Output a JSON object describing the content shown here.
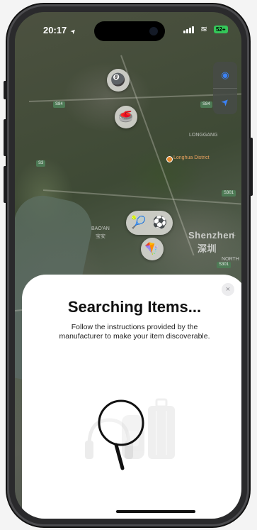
{
  "status_bar": {
    "time": "20:17",
    "location_arrow": "➤",
    "wifi": "≋",
    "battery": "52+"
  },
  "map": {
    "labels": {
      "longgang": "LONGGANG",
      "baoan": "BAO'AN",
      "baoan_cn": "宝安",
      "shenzhen": "Shenzhen",
      "shenzhen_cn": "深圳",
      "north": "NORTH",
      "l_edge": "L",
      "poi": "Longhua District"
    },
    "road_shields": [
      "S84",
      "S84",
      "S3",
      "S301",
      "S301"
    ],
    "controls": {
      "map_icon": "◉",
      "locate_icon": "➤"
    },
    "pins": {
      "pin_1": "🎱",
      "pin_2": "🥌",
      "pin_3a": "🎾",
      "pin_3b": "⚽",
      "pin_4": "🪁"
    }
  },
  "sheet": {
    "close_label": "×",
    "title": "Searching Items...",
    "description": "Follow the instructions provided by the manufacturer to make your item discoverable."
  },
  "colors": {
    "accent": "#3b82f6",
    "battery": "#34c759",
    "poi": "#e58a2f"
  }
}
